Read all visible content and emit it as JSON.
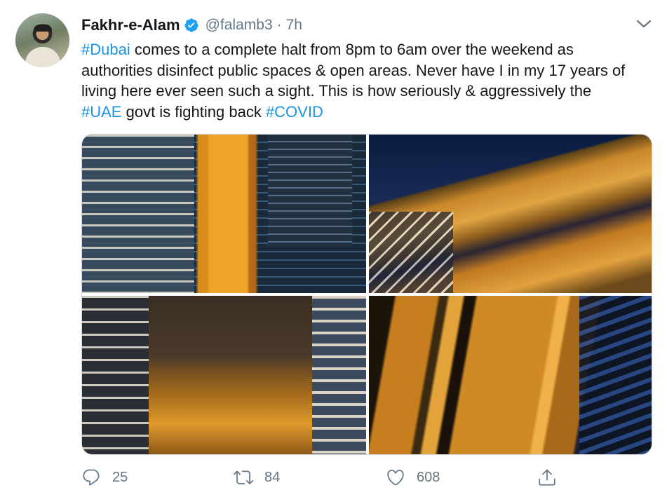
{
  "author": {
    "display_name": "Fakhr-e-Alam",
    "handle": "@falamb3",
    "separator": "·",
    "time": "7h"
  },
  "tweet": {
    "segments": [
      {
        "text": "#Dubai",
        "hashtag": true
      },
      {
        "text": " comes to a complete halt from 8pm to 6am over the weekend as authorities disinfect public spaces & open areas. Never have I in my 17 years of living here ever seen such a sight. This is how seriously & aggressively the ",
        "hashtag": false
      },
      {
        "text": "#UAE",
        "hashtag": true
      },
      {
        "text": " govt is fighting back ",
        "hashtag": false
      },
      {
        "text": "#COVID",
        "hashtag": true
      }
    ]
  },
  "actions": {
    "reply_count": "25",
    "retweet_count": "84",
    "like_count": "608"
  },
  "icons": {
    "verified": "verified-badge-icon",
    "more": "chevron-down-icon",
    "reply": "reply-icon",
    "retweet": "retweet-icon",
    "like": "heart-icon",
    "share": "share-icon"
  },
  "colors": {
    "link": "#1b95e0",
    "secondary_text": "#657786",
    "primary_text": "#14171a"
  }
}
